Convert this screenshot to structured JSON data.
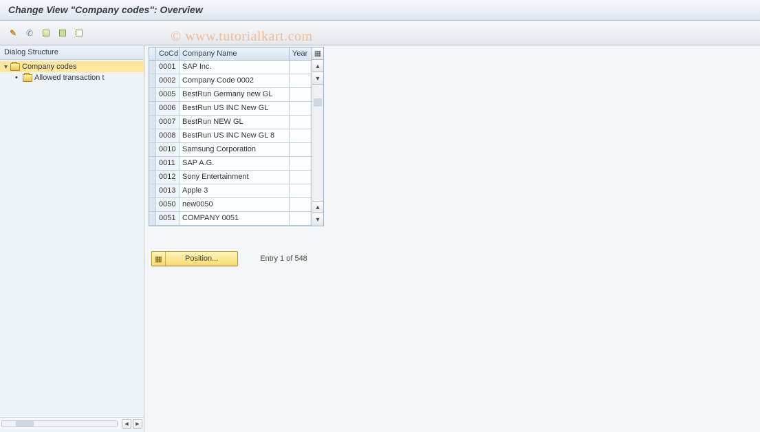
{
  "title": "Change View \"Company codes\": Overview",
  "watermark": "© www.tutorialkart.com",
  "toolbar_icons": {
    "change": "pencil-icon",
    "back": "glasses-icon",
    "select_all": "select-all-icon",
    "select_block": "select-block-icon",
    "deselect": "deselect-icon"
  },
  "dialog_structure": {
    "header": "Dialog Structure",
    "root": {
      "label": "Company codes",
      "expanded": true,
      "selected": true
    },
    "child": {
      "label": "Allowed transaction t"
    }
  },
  "table": {
    "columns": {
      "sel": "",
      "cocd": "CoCd",
      "name": "Company Name",
      "year": "Year"
    },
    "rows": [
      {
        "cocd": "0001",
        "name": "SAP Inc.",
        "year": ""
      },
      {
        "cocd": "0002",
        "name": "Company Code 0002",
        "year": ""
      },
      {
        "cocd": "0005",
        "name": "BestRun Germany new GL",
        "year": ""
      },
      {
        "cocd": "0006",
        "name": "BestRun US INC New GL",
        "year": ""
      },
      {
        "cocd": "0007",
        "name": "BestRun NEW GL",
        "year": ""
      },
      {
        "cocd": "0008",
        "name": "BestRun US INC New GL 8",
        "year": ""
      },
      {
        "cocd": "0010",
        "name": "Samsung Corporation",
        "year": ""
      },
      {
        "cocd": "0011",
        "name": "SAP A.G.",
        "year": ""
      },
      {
        "cocd": "0012",
        "name": "Sony Entertainment",
        "year": ""
      },
      {
        "cocd": "0013",
        "name": "Apple 3",
        "year": ""
      },
      {
        "cocd": "0050",
        "name": "new0050",
        "year": ""
      },
      {
        "cocd": "0051",
        "name": "COMPANY 0051",
        "year": ""
      }
    ]
  },
  "position_button": "Position...",
  "entry_status": "Entry 1 of 548"
}
